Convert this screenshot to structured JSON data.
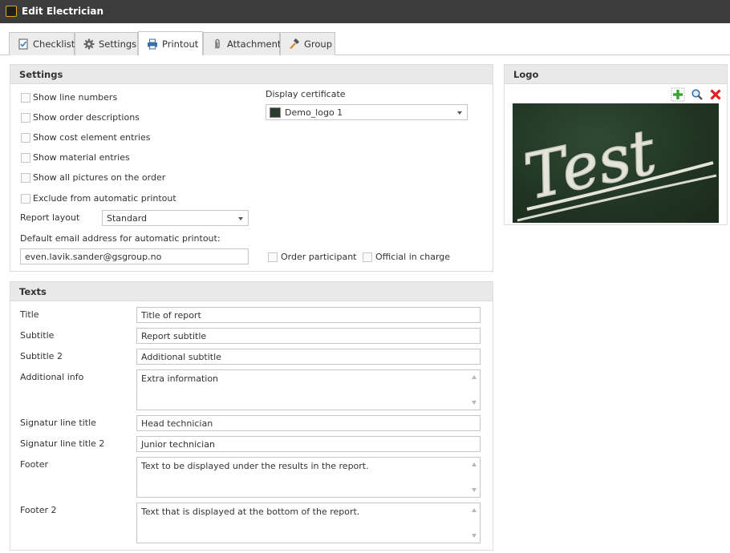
{
  "window": {
    "title": "Edit Electrician"
  },
  "tabs": [
    {
      "label": "Checklist",
      "icon": "checklist-icon"
    },
    {
      "label": "Settings",
      "icon": "gear-icon"
    },
    {
      "label": "Printout",
      "icon": "printer-icon",
      "active": true
    },
    {
      "label": "Attachment",
      "icon": "paperclip-icon"
    },
    {
      "label": "Group",
      "icon": "hammer-icon"
    }
  ],
  "settings": {
    "header": "Settings",
    "checkboxes": [
      {
        "label": "Show line numbers",
        "checked": false
      },
      {
        "label": "Show order descriptions",
        "checked": false
      },
      {
        "label": "Show cost element entries",
        "checked": false
      },
      {
        "label": "Show material entries",
        "checked": false
      },
      {
        "label": "Show all pictures on the order",
        "checked": false
      },
      {
        "label": "Exclude from automatic printout",
        "checked": false
      }
    ],
    "display_certificate": {
      "label": "Display certificate",
      "value": "Demo_logo 1"
    },
    "report_layout": {
      "label": "Report layout",
      "value": "Standard"
    },
    "email": {
      "label": "Default email address for automatic printout:",
      "value": "even.lavik.sander@gsgroup.no"
    },
    "order_participant": {
      "label": "Order participant",
      "checked": false
    },
    "official_in_charge": {
      "label": "Official in charge",
      "checked": false
    }
  },
  "logo": {
    "header": "Logo",
    "image_text": "Test",
    "accent_add": "#3aa335",
    "accent_delete": "#e02020"
  },
  "texts": {
    "header": "Texts",
    "fields": [
      {
        "label": "Title",
        "value": "Title of report",
        "type": "input"
      },
      {
        "label": "Subtitle",
        "value": "Report subtitle",
        "type": "input"
      },
      {
        "label": "Subtitle 2",
        "value": "Additional subtitle",
        "type": "input"
      },
      {
        "label": "Additional info",
        "value": "Extra information",
        "type": "textarea"
      },
      {
        "label": "Signatur line title",
        "value": "Head technician",
        "type": "input"
      },
      {
        "label": "Signatur line title 2",
        "value": "Junior technician",
        "type": "input"
      },
      {
        "label": "Footer",
        "value": "Text to be displayed under the results in the report.",
        "type": "textarea"
      },
      {
        "label": "Footer 2",
        "value": "Text that is displayed at the bottom of the report.",
        "type": "textarea"
      }
    ]
  }
}
